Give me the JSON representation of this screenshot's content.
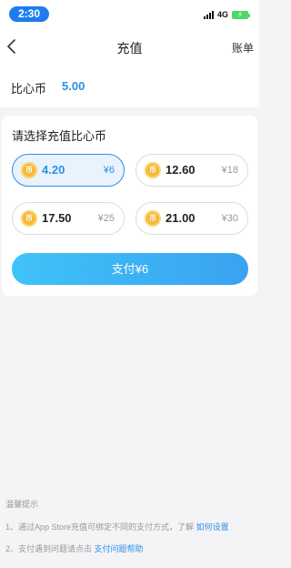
{
  "status_bar": {
    "time": "2:30",
    "network": "4G"
  },
  "nav": {
    "title": "充值",
    "right_label": "账单"
  },
  "balance": {
    "label": "比心币",
    "value": "5.00"
  },
  "recharge": {
    "title": "请选择充值比心币",
    "options": [
      {
        "amount": "4.20",
        "price": "¥6",
        "selected": true
      },
      {
        "amount": "12.60",
        "price": "¥18",
        "selected": false
      },
      {
        "amount": "17.50",
        "price": "¥25",
        "selected": false
      },
      {
        "amount": "21.00",
        "price": "¥30",
        "selected": false
      }
    ],
    "pay_label": "支付¥6"
  },
  "tips": {
    "title": "温馨提示",
    "items": [
      {
        "text": "1、通过App Store充值可绑定不同的支付方式，了解",
        "link": "如何设置"
      },
      {
        "text": "2、支付遇到问题请点击",
        "link": "支付问题帮助"
      }
    ]
  },
  "colors": {
    "accent": "#2b8fe8",
    "pay_gradient_start": "#3fc3f7",
    "pay_gradient_end": "#3aa2f2",
    "coin": "#f6b93b"
  }
}
